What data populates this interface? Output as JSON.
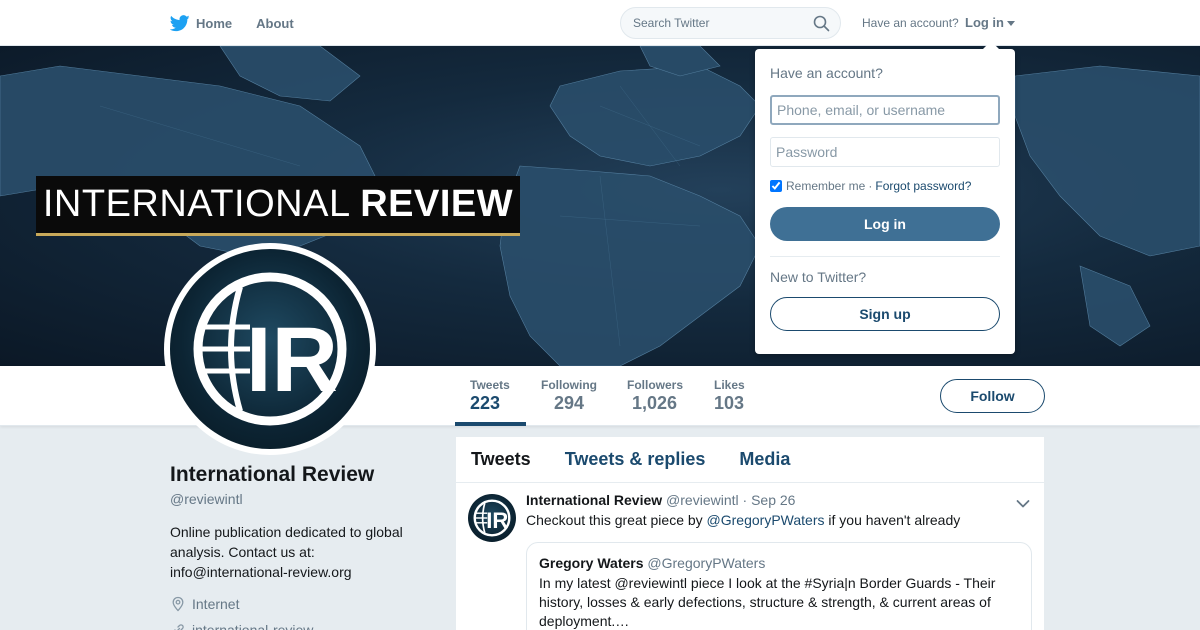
{
  "nav": {
    "home_label": "Home",
    "about_label": "About",
    "search_placeholder": "Search Twitter",
    "have_account_text": "Have an account?",
    "login_label": "Log in"
  },
  "banner": {
    "brand_light": "INTERNATIONAL",
    "brand_bold": "REVIEW"
  },
  "profile": {
    "avatar_text": "IR",
    "name": "International Review",
    "handle": "@reviewintl",
    "bio": "Online publication dedicated to global analysis. Contact us at: info@international-review.org",
    "location": "Internet",
    "website": "international-review..."
  },
  "stats": [
    {
      "label": "Tweets",
      "value": "223"
    },
    {
      "label": "Following",
      "value": "294"
    },
    {
      "label": "Followers",
      "value": "1,026"
    },
    {
      "label": "Likes",
      "value": "103"
    }
  ],
  "follow_label": "Follow",
  "tabs": [
    {
      "label": "Tweets"
    },
    {
      "label": "Tweets & replies"
    },
    {
      "label": "Media"
    }
  ],
  "tweet": {
    "name": "International Review",
    "handle": "@reviewintl",
    "dot": "·",
    "date": "Sep 26",
    "text_before": "Checkout this great piece by",
    "mention": "@GregoryPWaters",
    "text_after": "if you haven't already",
    "quote": {
      "name": "Gregory Waters",
      "handle": "@GregoryPWaters",
      "text": "In my latest @reviewintl piece I look at the #Syria|n Border Guards - Their history, losses & early defections, structure & strength, & current areas of deployment.…"
    }
  },
  "login_dropdown": {
    "title": "Have an account?",
    "username_placeholder": "Phone, email, or username",
    "password_placeholder": "Password",
    "remember_label": "Remember me",
    "separator": "·",
    "forgot_label": "Forgot password?",
    "login_button": "Log in",
    "new_text": "New to Twitter?",
    "signup_button": "Sign up"
  },
  "colors": {
    "accent": "#1b4a6e",
    "button_fill": "#3f7095",
    "muted_text": "#657786",
    "page_bg": "#e6ecf0",
    "brand_underline": "#c8a95a"
  }
}
